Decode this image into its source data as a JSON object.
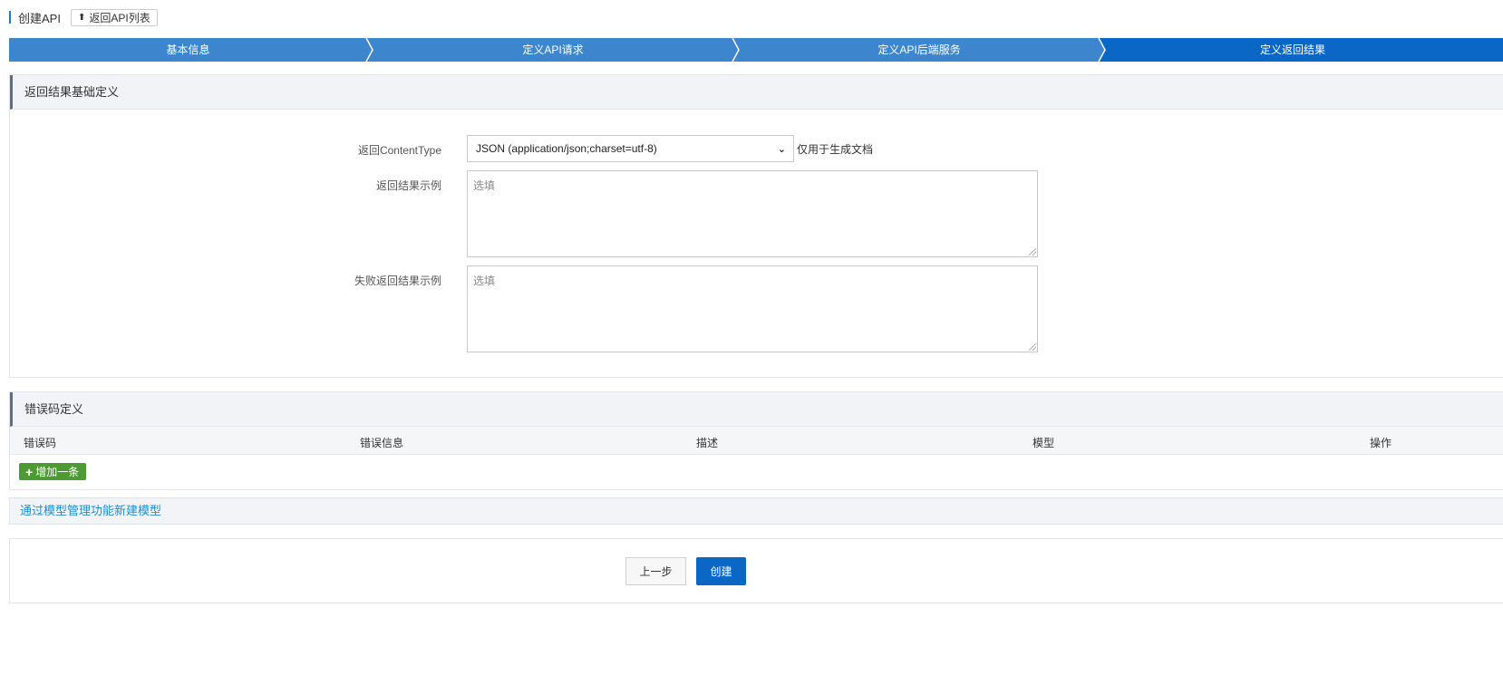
{
  "header": {
    "title": "创建API",
    "back_label": "返回API列表",
    "back_icon": "upload-arrow-icon"
  },
  "steps": [
    {
      "label": "基本信息",
      "active": false
    },
    {
      "label": "定义API请求",
      "active": false
    },
    {
      "label": "定义API后端服务",
      "active": false
    },
    {
      "label": "定义返回结果",
      "active": true
    }
  ],
  "colors": {
    "step_bg": "#3d86cd",
    "step_active_bg": "#0a67c6",
    "add_button": "#4d9a32",
    "link": "#1c8fd3",
    "primary_button": "#0a67c6"
  },
  "result_section": {
    "title": "返回结果基础定义",
    "content_type_label": "返回ContentType",
    "content_type_value": "JSON (application/json;charset=utf-8)",
    "content_type_hint": "仅用于生成文档",
    "success_example_label": "返回结果示例",
    "success_example_placeholder": "选填",
    "failure_example_label": "失败返回结果示例",
    "failure_example_placeholder": "选填"
  },
  "error_section": {
    "title": "错误码定义",
    "columns": [
      "错误码",
      "错误信息",
      "描述",
      "模型",
      "操作"
    ],
    "add_label": "增加一条"
  },
  "model_link": "通过模型管理功能新建模型",
  "footer": {
    "prev_label": "上一步",
    "create_label": "创建"
  }
}
